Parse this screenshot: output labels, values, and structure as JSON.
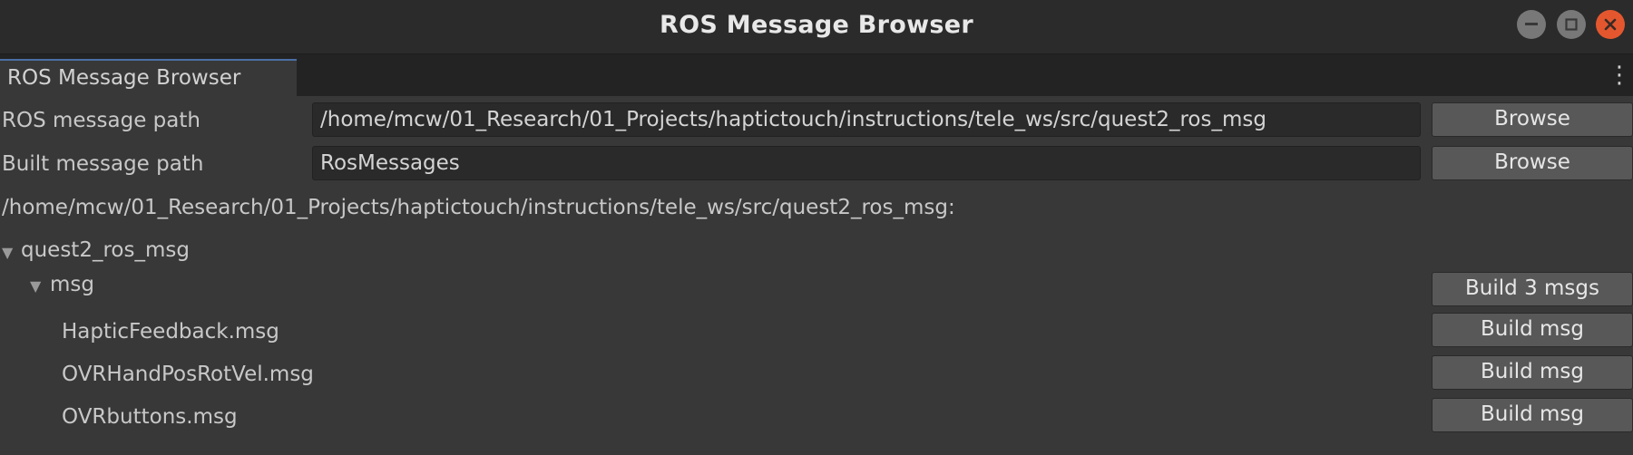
{
  "window": {
    "title": "ROS Message Browser",
    "controls": [
      "minimize-icon",
      "maximize-icon",
      "close-icon"
    ],
    "close_color": "#e4572e"
  },
  "tab": {
    "label": "ROS Message Browser",
    "menu_icon": "kebab-menu-icon"
  },
  "fields": {
    "ros_message_path": {
      "label": "ROS message path",
      "value": "/home/mcw/01_Research/01_Projects/haptictouch/instructions/tele_ws/src/quest2_ros_msg",
      "button": "Browse"
    },
    "built_message_path": {
      "label": "Built message path",
      "value": "RosMessages",
      "button": "Browse"
    }
  },
  "tree": {
    "root_path": "/home/mcw/01_Research/01_Projects/haptictouch/instructions/tele_ws/src/quest2_ros_msg:",
    "package": {
      "name": "quest2_ros_msg",
      "expanded": true
    },
    "folder": {
      "name": "msg",
      "expanded": true,
      "build_button": "Build 3 msgs"
    },
    "files": [
      {
        "name": "HapticFeedback.msg",
        "button": "Build msg"
      },
      {
        "name": "OVRHandPosRotVel.msg",
        "button": "Build msg"
      },
      {
        "name": "OVRbuttons.msg",
        "button": "Build msg"
      }
    ]
  }
}
